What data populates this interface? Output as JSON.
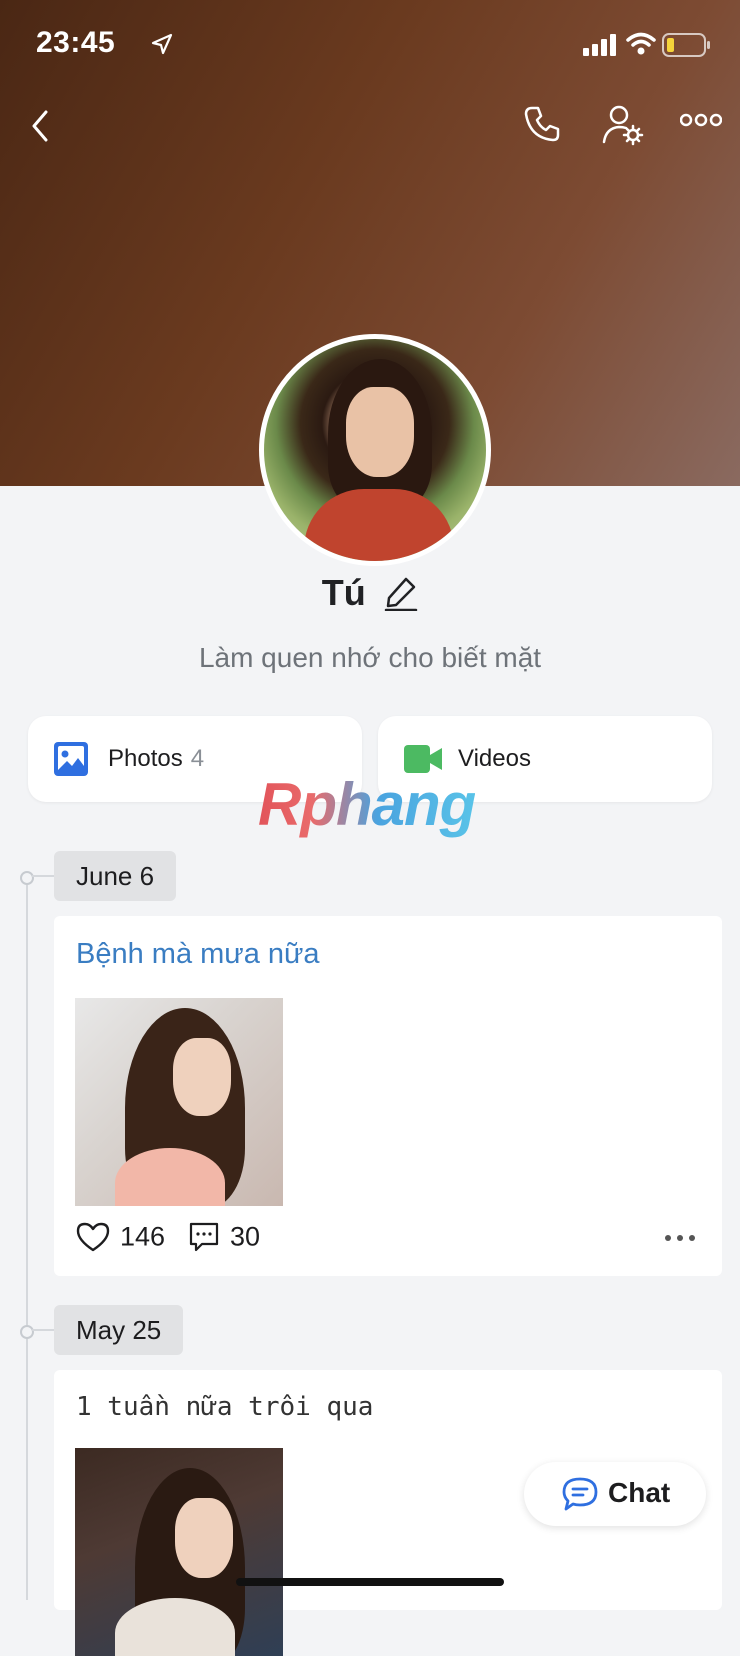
{
  "status_bar": {
    "time": "23:45"
  },
  "profile": {
    "name": "Tú",
    "status": "Làm quen nhớ cho biết mặt"
  },
  "media": {
    "photos_label": "Photos",
    "photos_count": "4",
    "videos_label": "Videos"
  },
  "watermark": "Rphang",
  "timeline": [
    {
      "date": "June 6",
      "text": "Bệnh mà mưa nữa",
      "likes": "146",
      "comments": "30"
    },
    {
      "date": "May 25",
      "text": "1 tuần nữa trôi qua"
    }
  ],
  "chat_button": {
    "label": "Chat"
  },
  "colors": {
    "accent_blue": "#3a7dc2",
    "photos_icon": "#2f6fe0",
    "videos_icon": "#4cba62"
  }
}
